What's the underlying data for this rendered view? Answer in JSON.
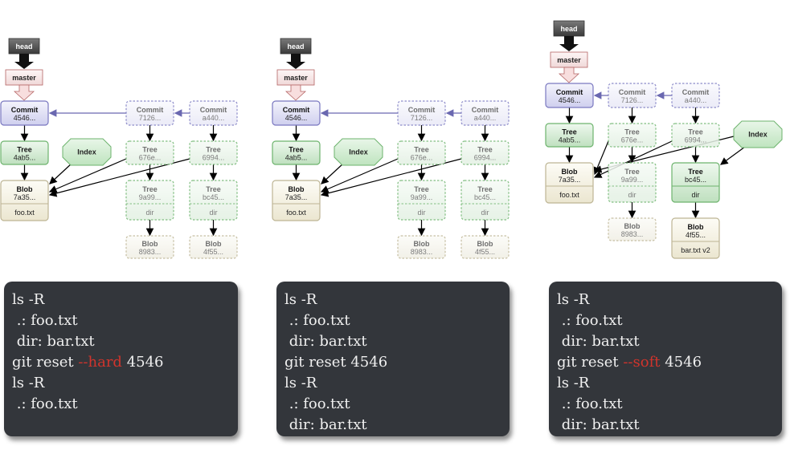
{
  "panels": [
    {
      "name": "reset-hard",
      "labels": {
        "head": "head",
        "master": "master",
        "commit_current": {
          "title": "Commit",
          "hash": "4546..."
        },
        "commit_2": {
          "title": "Commit",
          "hash": "7126..."
        },
        "commit_3": {
          "title": "Commit",
          "hash": "a440..."
        },
        "tree_current": {
          "title": "Tree",
          "hash": "4ab5..."
        },
        "tree_2": {
          "title": "Tree",
          "hash": "676e..."
        },
        "tree_3": {
          "title": "Tree",
          "hash": "6994..."
        },
        "subtree_2": {
          "title": "Tree",
          "hash": "9a99...",
          "name": "dir"
        },
        "subtree_3": {
          "title": "Tree",
          "hash": "bc45...",
          "name": "dir"
        },
        "blob_current": {
          "title": "Blob",
          "hash": "7a35...",
          "name": "foo.txt"
        },
        "blob_2": {
          "title": "Blob",
          "hash": "8983..."
        },
        "blob_3": {
          "title": "Blob",
          "hash": "4f55..."
        },
        "index": "Index"
      },
      "terminal": [
        {
          "text": "ls -R"
        },
        {
          "text": " .: foo.txt"
        },
        {
          "text": " dir: bar.txt"
        },
        {
          "pre": "git reset ",
          "flag": "--hard",
          "post": " 4546"
        },
        {
          "text": "ls -R"
        },
        {
          "text": " .: foo.txt"
        }
      ]
    },
    {
      "name": "reset-mixed",
      "labels": {
        "head": "head",
        "master": "master",
        "commit_current": {
          "title": "Commit",
          "hash": "4546..."
        },
        "commit_2": {
          "title": "Commit",
          "hash": "7126..."
        },
        "commit_3": {
          "title": "Commit",
          "hash": "a440..."
        },
        "tree_current": {
          "title": "Tree",
          "hash": "4ab5..."
        },
        "tree_2": {
          "title": "Tree",
          "hash": "676e..."
        },
        "tree_3": {
          "title": "Tree",
          "hash": "6994..."
        },
        "subtree_2": {
          "title": "Tree",
          "hash": "9a99...",
          "name": "dir"
        },
        "subtree_3": {
          "title": "Tree",
          "hash": "bc45...",
          "name": "dir"
        },
        "blob_current": {
          "title": "Blob",
          "hash": "7a35...",
          "name": "foo.txt"
        },
        "blob_2": {
          "title": "Blob",
          "hash": "8983..."
        },
        "blob_3": {
          "title": "Blob",
          "hash": "4f55..."
        },
        "index": "Index"
      },
      "terminal": [
        {
          "text": "ls -R"
        },
        {
          "text": " .: foo.txt"
        },
        {
          "text": " dir: bar.txt"
        },
        {
          "text": "git reset 4546"
        },
        {
          "text": "ls -R"
        },
        {
          "text": " .: foo.txt"
        },
        {
          "text": " dir: bar.txt"
        }
      ]
    },
    {
      "name": "reset-soft",
      "labels": {
        "head": "head",
        "master": "master",
        "commit_current": {
          "title": "Commit",
          "hash": "4546..."
        },
        "commit_2": {
          "title": "Commit",
          "hash": "7126..."
        },
        "commit_3": {
          "title": "Commit",
          "hash": "a440..."
        },
        "tree_current": {
          "title": "Tree",
          "hash": "4ab5..."
        },
        "tree_2": {
          "title": "Tree",
          "hash": "676e..."
        },
        "tree_3": {
          "title": "Tree",
          "hash": "6994..."
        },
        "subtree_2": {
          "title": "Tree",
          "hash": "9a99...",
          "name": "dir"
        },
        "subtree_3": {
          "title": "Tree",
          "hash": "bc45...",
          "name": "dir"
        },
        "blob_current": {
          "title": "Blob",
          "hash": "7a35...",
          "name": "foo.txt"
        },
        "blob_2": {
          "title": "Blob",
          "hash": "8983..."
        },
        "blob_3": {
          "title": "Blob",
          "hash": "4f55...",
          "name": "bar.txt v2"
        },
        "index": "Index"
      },
      "terminal": [
        {
          "text": "ls -R"
        },
        {
          "text": " .: foo.txt"
        },
        {
          "text": " dir: bar.txt"
        },
        {
          "pre": "git reset ",
          "flag": "--soft",
          "post": " 4546"
        },
        {
          "text": "ls -R"
        },
        {
          "text": " .: foo.txt"
        },
        {
          "text": " dir: bar.txt"
        }
      ]
    }
  ],
  "colors": {
    "commit_fill": "#e4e4f6",
    "commit_stroke": "#7a78c0",
    "tree_fill": "#d6ecd6",
    "tree_stroke": "#6db36d",
    "blob_fill": "#f7f4e8",
    "blob_stroke": "#bdb594",
    "ref_fill": "#f7e6e6",
    "ref_stroke": "#b46464",
    "head_fill": "#5b5b5b",
    "flag": "#d0342c",
    "terminal_bg": "#33363b"
  }
}
